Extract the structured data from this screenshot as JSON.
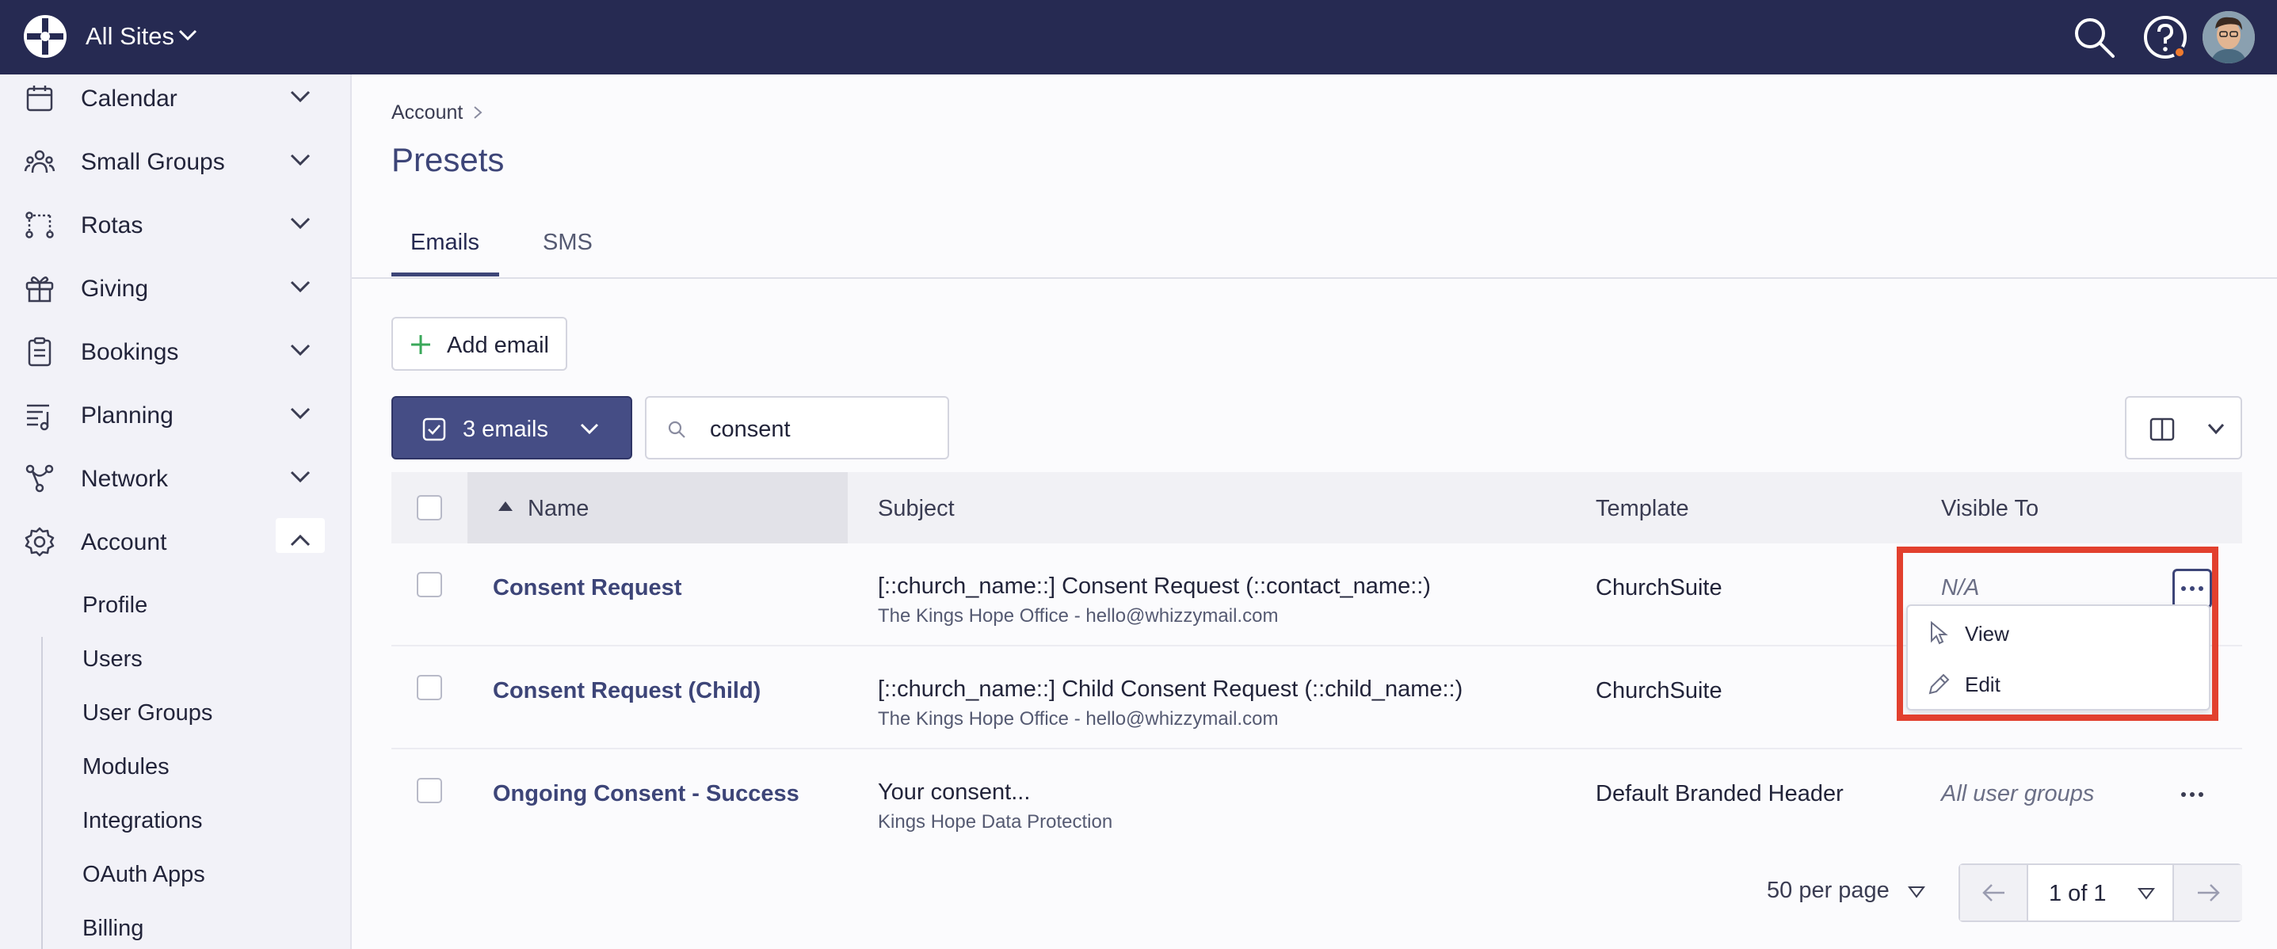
{
  "header": {
    "site_label": "All Sites",
    "icons": [
      "logo-icon",
      "chevron-down-icon",
      "search-icon",
      "help-icon",
      "avatar"
    ],
    "notification_color": "#f07a2e",
    "bar_color": "#262a52"
  },
  "sidebar": {
    "items": [
      {
        "label": "Calendar",
        "icon": "calendar-icon"
      },
      {
        "label": "Small Groups",
        "icon": "people-icon"
      },
      {
        "label": "Rotas",
        "icon": "rotas-icon"
      },
      {
        "label": "Giving",
        "icon": "gift-icon"
      },
      {
        "label": "Bookings",
        "icon": "clipboard-icon"
      },
      {
        "label": "Planning",
        "icon": "planning-icon"
      },
      {
        "label": "Network",
        "icon": "network-icon"
      },
      {
        "label": "Account",
        "icon": "gear-icon",
        "expanded": true
      }
    ],
    "account_sub": [
      "Profile",
      "Users",
      "User Groups",
      "Modules",
      "Integrations",
      "OAuth Apps",
      "Billing"
    ]
  },
  "main": {
    "breadcrumb": "Account",
    "title": "Presets",
    "tabs": [
      "Emails",
      "SMS"
    ],
    "active_tab": "Emails",
    "add_button": "Add email",
    "selection_button": "3 emails",
    "search": {
      "value": "consent",
      "placeholder": ""
    },
    "table": {
      "headers": [
        "Name",
        "Subject",
        "Template",
        "Visible To"
      ],
      "rows": [
        {
          "name": "Consent Request",
          "subject": "[::church_name::] Consent Request (::contact_name::)",
          "from": "The Kings Hope Office - hello@whizzymail.com",
          "template": "ChurchSuite",
          "visible": "N/A"
        },
        {
          "name": "Consent Request (Child)",
          "subject": "[::church_name::] Child Consent Request (::child_name::)",
          "from": "The Kings Hope Office - hello@whizzymail.com",
          "template": "ChurchSuite",
          "visible": ""
        },
        {
          "name": "Ongoing Consent - Success",
          "subject": "Your consent...",
          "from": "Kings Hope Data Protection",
          "template": "Default Branded Header",
          "visible": "All user groups"
        }
      ]
    },
    "row_menu": {
      "items": [
        "View",
        "Edit"
      ]
    },
    "pagination": {
      "per_page": "50 per page",
      "page": "1 of 1"
    },
    "highlight_color": "#e2402e",
    "accent_color": "#3d4578"
  }
}
